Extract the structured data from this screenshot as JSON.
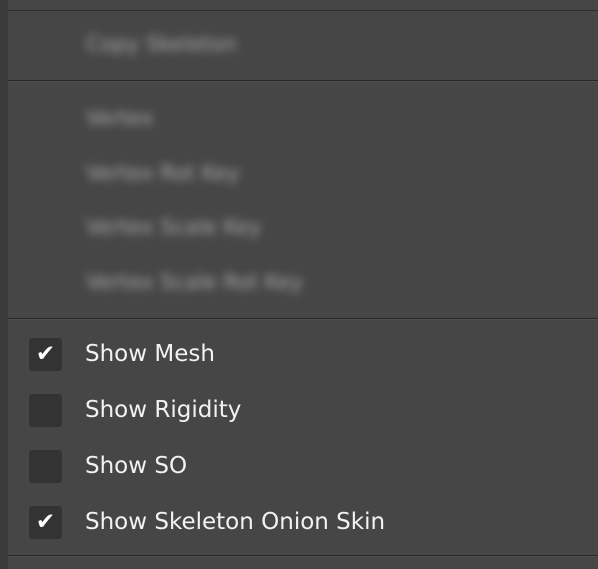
{
  "menu": {
    "blurred_items": [
      "Copy Skeleton",
      "Vertex",
      "Vertex Rot Key",
      "Vertex Scale Key",
      "Vertex Scale Rot Key"
    ],
    "toggle_items": [
      {
        "label": "Show Mesh",
        "checked": true,
        "check_glyph": "✔"
      },
      {
        "label": "Show Rigidity",
        "checked": false,
        "check_glyph": ""
      },
      {
        "label": "Show SO",
        "checked": false,
        "check_glyph": ""
      },
      {
        "label": "Show Skeleton Onion Skin",
        "checked": true,
        "check_glyph": "✔"
      }
    ]
  }
}
